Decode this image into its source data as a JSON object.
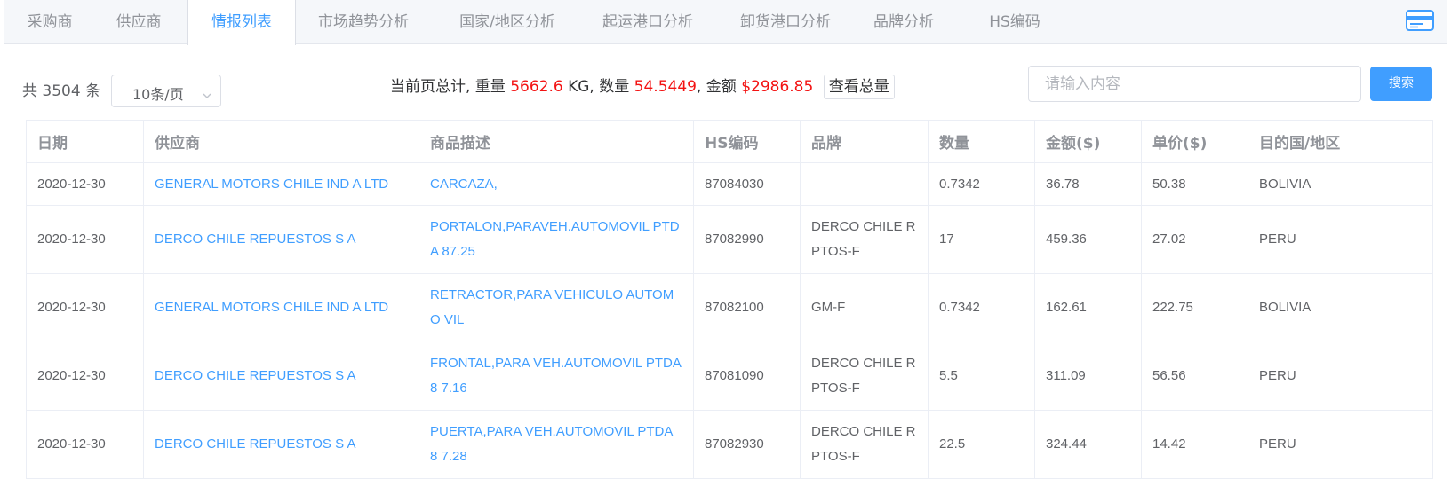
{
  "tabs": [
    {
      "label": "采购商"
    },
    {
      "label": "供应商"
    },
    {
      "label": "情报列表"
    },
    {
      "label": "市场趋势分析"
    },
    {
      "label": "国家/地区分析"
    },
    {
      "label": "起运港口分析"
    },
    {
      "label": "卸货港口分析"
    },
    {
      "label": "品牌分析"
    },
    {
      "label": "HS编码"
    }
  ],
  "active_tab": "情报列表",
  "toolbar": {
    "total": "共 3504 条",
    "page_size": "10条/页",
    "summary_prefix": "当前页总计, 重量",
    "weight": "5662.6",
    "weight_unit": "KG, 数量",
    "quantity": "54.5449",
    "amount_label": ", 金额",
    "amount": "$2986.85",
    "view_total": "查看总量",
    "search_placeholder": "请输入内容",
    "search_button": "搜索"
  },
  "colors": {
    "accent": "#409eff",
    "highlight_red": "#f31313"
  },
  "table": {
    "headers": [
      "日期",
      "供应商",
      "商品描述",
      "HS编码",
      "品牌",
      "数量",
      "金额($)",
      "单价($)",
      "目的国/地区"
    ],
    "rows": [
      {
        "date": "2020-12-30",
        "supplier": "GENERAL MOTORS CHILE IND A LTD",
        "desc": "CARCAZA,",
        "hs": "87084030",
        "brand": "",
        "qty": "0.7342",
        "amount": "36.78",
        "price": "50.38",
        "dest": "BOLIVIA"
      },
      {
        "date": "2020-12-30",
        "supplier": "DERCO CHILE REPUESTOS S A",
        "desc": "PORTALON,PARAVEH.AUTOMOVIL PTDA 87.25",
        "hs": "87082990",
        "brand": "DERCO CHILE R PTOS-F",
        "qty": "17",
        "amount": "459.36",
        "price": "27.02",
        "dest": "PERU"
      },
      {
        "date": "2020-12-30",
        "supplier": "GENERAL MOTORS CHILE IND A LTD",
        "desc": "RETRACTOR,PARA VEHICULO AUTOMO VIL",
        "hs": "87082100",
        "brand": "GM-F",
        "qty": "0.7342",
        "amount": "162.61",
        "price": "222.75",
        "dest": "BOLIVIA"
      },
      {
        "date": "2020-12-30",
        "supplier": "DERCO CHILE REPUESTOS S A",
        "desc": "FRONTAL,PARA VEH.AUTOMOVIL PTDA 8 7.16",
        "hs": "87081090",
        "brand": "DERCO CHILE R PTOS-F",
        "qty": "5.5",
        "amount": "311.09",
        "price": "56.56",
        "dest": "PERU"
      },
      {
        "date": "2020-12-30",
        "supplier": "DERCO CHILE REPUESTOS S A",
        "desc": "PUERTA,PARA VEH.AUTOMOVIL PTDA 8 7.28",
        "hs": "87082930",
        "brand": "DERCO CHILE R PTOS-F",
        "qty": "22.5",
        "amount": "324.44",
        "price": "14.42",
        "dest": "PERU"
      }
    ]
  }
}
